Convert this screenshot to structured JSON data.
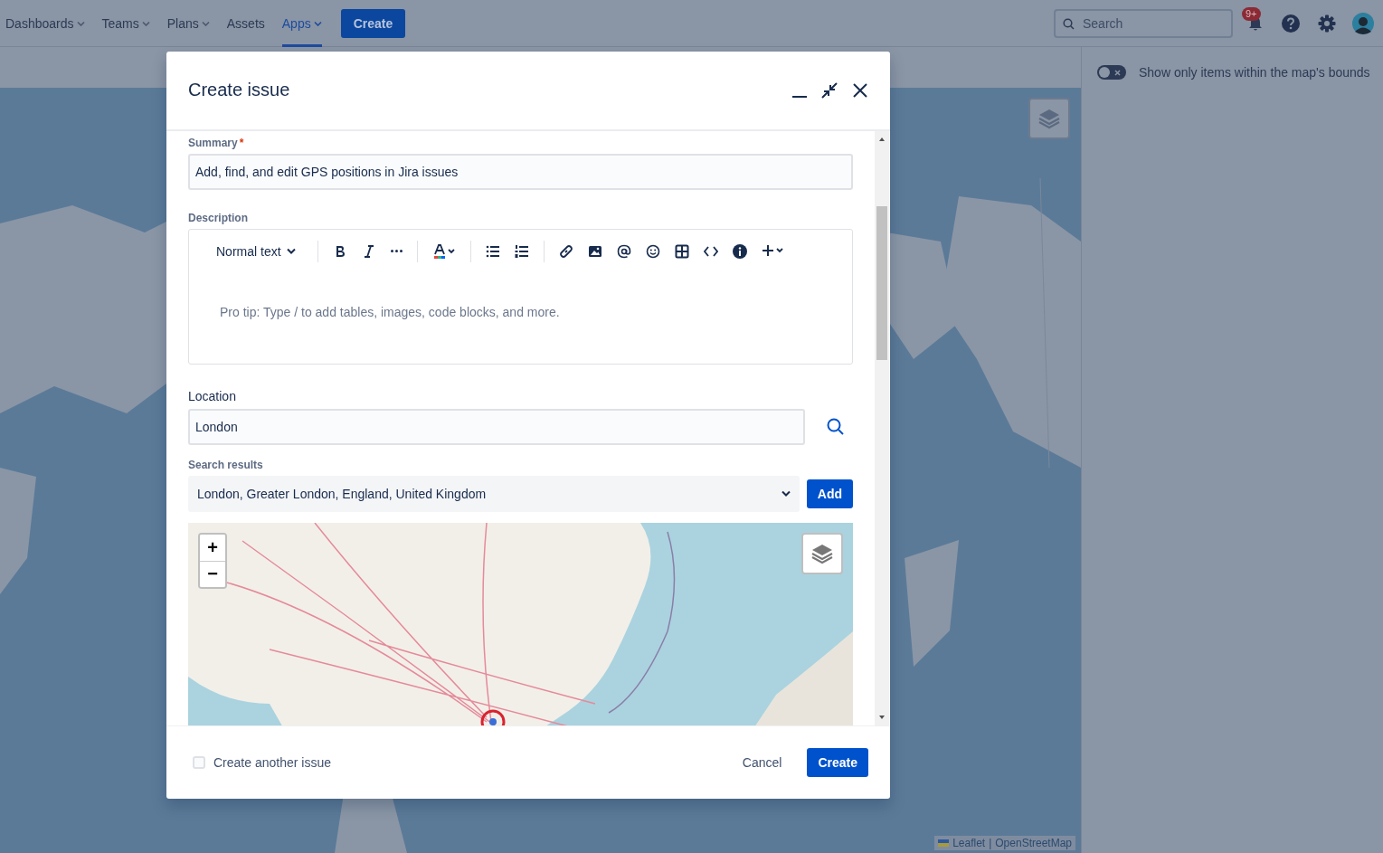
{
  "nav": {
    "items": [
      {
        "label": "Dashboards",
        "dropdown": true,
        "selected": false
      },
      {
        "label": "Teams",
        "dropdown": true,
        "selected": false
      },
      {
        "label": "Plans",
        "dropdown": true,
        "selected": false
      },
      {
        "label": "Assets",
        "dropdown": false,
        "selected": false
      },
      {
        "label": "Apps",
        "dropdown": true,
        "selected": true
      }
    ],
    "create_button": "Create",
    "search": {
      "placeholder": "Search"
    },
    "notification_badge": "9+"
  },
  "side_panel": {
    "toggle": {
      "label": "Show only items within the map's bounds",
      "on": false
    }
  },
  "map_attribution": {
    "links": [
      "Leaflet",
      "OpenStreetMap"
    ],
    "separator": "|"
  },
  "dialog": {
    "title": "Create issue",
    "summary": {
      "label": "Summary",
      "required_mark": "*",
      "value": "Add, find, and edit GPS positions in Jira issues"
    },
    "description": {
      "label": "Description",
      "text_style": "Normal text",
      "placeholder": "Pro tip: Type / to add tables, images, code blocks, and more."
    },
    "location": {
      "label": "Location",
      "value": "London"
    },
    "search_results": {
      "label": "Search results",
      "value": "London, Greater London, England, United Kingdom",
      "add_button": "Add"
    },
    "map": {
      "kind": "picture",
      "zoom_in": "+",
      "zoom_out": "−"
    },
    "create_another": {
      "label": "Create another issue",
      "checked": false
    },
    "cancel_button": "Cancel",
    "create_button": "Create"
  }
}
